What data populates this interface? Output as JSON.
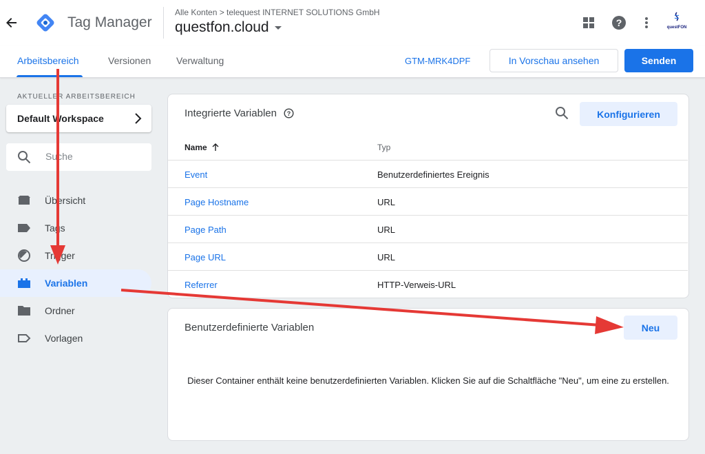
{
  "header": {
    "app_title": "Tag Manager",
    "breadcrumb": "Alle Konten > telequest INTERNET SOLUTIONS GmbH",
    "container_name": "questfon.cloud",
    "user_brand": "questFON"
  },
  "tabs": [
    {
      "label": "Arbeitsbereich",
      "active": true
    },
    {
      "label": "Versionen",
      "active": false
    },
    {
      "label": "Verwaltung",
      "active": false
    }
  ],
  "toolbar": {
    "container_id": "GTM-MRK4DPF",
    "preview_label": "In Vorschau ansehen",
    "send_label": "Senden"
  },
  "sidebar": {
    "workspace_label": "AKTUELLER ARBEITSBEREICH",
    "workspace_name": "Default Workspace",
    "search_placeholder": "Suche",
    "items": [
      {
        "label": "Übersicht",
        "icon": "overview-icon"
      },
      {
        "label": "Tags",
        "icon": "tag-icon"
      },
      {
        "label": "Trigger",
        "icon": "trigger-icon"
      },
      {
        "label": "Variablen",
        "icon": "variables-icon",
        "active": true
      },
      {
        "label": "Ordner",
        "icon": "folder-icon"
      },
      {
        "label": "Vorlagen",
        "icon": "template-icon"
      }
    ]
  },
  "builtin_variables": {
    "title": "Integrierte Variablen",
    "configure_label": "Konfigurieren",
    "columns": {
      "name": "Name",
      "type": "Typ"
    },
    "rows": [
      {
        "name": "Event",
        "type": "Benutzerdefiniertes Ereignis"
      },
      {
        "name": "Page Hostname",
        "type": "URL"
      },
      {
        "name": "Page Path",
        "type": "URL"
      },
      {
        "name": "Page URL",
        "type": "URL"
      },
      {
        "name": "Referrer",
        "type": "HTTP-Verweis-URL"
      }
    ]
  },
  "custom_variables": {
    "title": "Benutzerdefinierte Variablen",
    "new_label": "Neu",
    "empty_message": "Dieser Container enthält keine benutzerdefinierten Variablen. Klicken Sie auf die Schaltfläche \"Neu\", um eine zu erstellen."
  },
  "colors": {
    "accent": "#1a73e8",
    "annotation_arrow": "#e53935"
  }
}
